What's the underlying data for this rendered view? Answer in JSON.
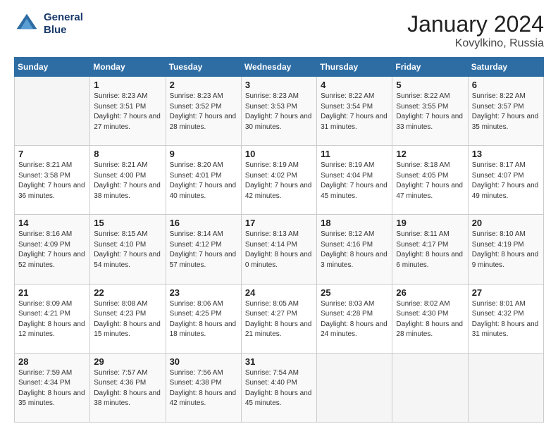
{
  "logo": {
    "line1": "General",
    "line2": "Blue"
  },
  "title": "January 2024",
  "subtitle": "Kovylkino, Russia",
  "columns": [
    "Sunday",
    "Monday",
    "Tuesday",
    "Wednesday",
    "Thursday",
    "Friday",
    "Saturday"
  ],
  "weeks": [
    [
      {
        "day": "",
        "sunrise": "",
        "sunset": "",
        "daylight": ""
      },
      {
        "day": "1",
        "sunrise": "Sunrise: 8:23 AM",
        "sunset": "Sunset: 3:51 PM",
        "daylight": "Daylight: 7 hours and 27 minutes."
      },
      {
        "day": "2",
        "sunrise": "Sunrise: 8:23 AM",
        "sunset": "Sunset: 3:52 PM",
        "daylight": "Daylight: 7 hours and 28 minutes."
      },
      {
        "day": "3",
        "sunrise": "Sunrise: 8:23 AM",
        "sunset": "Sunset: 3:53 PM",
        "daylight": "Daylight: 7 hours and 30 minutes."
      },
      {
        "day": "4",
        "sunrise": "Sunrise: 8:22 AM",
        "sunset": "Sunset: 3:54 PM",
        "daylight": "Daylight: 7 hours and 31 minutes."
      },
      {
        "day": "5",
        "sunrise": "Sunrise: 8:22 AM",
        "sunset": "Sunset: 3:55 PM",
        "daylight": "Daylight: 7 hours and 33 minutes."
      },
      {
        "day": "6",
        "sunrise": "Sunrise: 8:22 AM",
        "sunset": "Sunset: 3:57 PM",
        "daylight": "Daylight: 7 hours and 35 minutes."
      }
    ],
    [
      {
        "day": "7",
        "sunrise": "Sunrise: 8:21 AM",
        "sunset": "Sunset: 3:58 PM",
        "daylight": "Daylight: 7 hours and 36 minutes."
      },
      {
        "day": "8",
        "sunrise": "Sunrise: 8:21 AM",
        "sunset": "Sunset: 4:00 PM",
        "daylight": "Daylight: 7 hours and 38 minutes."
      },
      {
        "day": "9",
        "sunrise": "Sunrise: 8:20 AM",
        "sunset": "Sunset: 4:01 PM",
        "daylight": "Daylight: 7 hours and 40 minutes."
      },
      {
        "day": "10",
        "sunrise": "Sunrise: 8:19 AM",
        "sunset": "Sunset: 4:02 PM",
        "daylight": "Daylight: 7 hours and 42 minutes."
      },
      {
        "day": "11",
        "sunrise": "Sunrise: 8:19 AM",
        "sunset": "Sunset: 4:04 PM",
        "daylight": "Daylight: 7 hours and 45 minutes."
      },
      {
        "day": "12",
        "sunrise": "Sunrise: 8:18 AM",
        "sunset": "Sunset: 4:05 PM",
        "daylight": "Daylight: 7 hours and 47 minutes."
      },
      {
        "day": "13",
        "sunrise": "Sunrise: 8:17 AM",
        "sunset": "Sunset: 4:07 PM",
        "daylight": "Daylight: 7 hours and 49 minutes."
      }
    ],
    [
      {
        "day": "14",
        "sunrise": "Sunrise: 8:16 AM",
        "sunset": "Sunset: 4:09 PM",
        "daylight": "Daylight: 7 hours and 52 minutes."
      },
      {
        "day": "15",
        "sunrise": "Sunrise: 8:15 AM",
        "sunset": "Sunset: 4:10 PM",
        "daylight": "Daylight: 7 hours and 54 minutes."
      },
      {
        "day": "16",
        "sunrise": "Sunrise: 8:14 AM",
        "sunset": "Sunset: 4:12 PM",
        "daylight": "Daylight: 7 hours and 57 minutes."
      },
      {
        "day": "17",
        "sunrise": "Sunrise: 8:13 AM",
        "sunset": "Sunset: 4:14 PM",
        "daylight": "Daylight: 8 hours and 0 minutes."
      },
      {
        "day": "18",
        "sunrise": "Sunrise: 8:12 AM",
        "sunset": "Sunset: 4:16 PM",
        "daylight": "Daylight: 8 hours and 3 minutes."
      },
      {
        "day": "19",
        "sunrise": "Sunrise: 8:11 AM",
        "sunset": "Sunset: 4:17 PM",
        "daylight": "Daylight: 8 hours and 6 minutes."
      },
      {
        "day": "20",
        "sunrise": "Sunrise: 8:10 AM",
        "sunset": "Sunset: 4:19 PM",
        "daylight": "Daylight: 8 hours and 9 minutes."
      }
    ],
    [
      {
        "day": "21",
        "sunrise": "Sunrise: 8:09 AM",
        "sunset": "Sunset: 4:21 PM",
        "daylight": "Daylight: 8 hours and 12 minutes."
      },
      {
        "day": "22",
        "sunrise": "Sunrise: 8:08 AM",
        "sunset": "Sunset: 4:23 PM",
        "daylight": "Daylight: 8 hours and 15 minutes."
      },
      {
        "day": "23",
        "sunrise": "Sunrise: 8:06 AM",
        "sunset": "Sunset: 4:25 PM",
        "daylight": "Daylight: 8 hours and 18 minutes."
      },
      {
        "day": "24",
        "sunrise": "Sunrise: 8:05 AM",
        "sunset": "Sunset: 4:27 PM",
        "daylight": "Daylight: 8 hours and 21 minutes."
      },
      {
        "day": "25",
        "sunrise": "Sunrise: 8:03 AM",
        "sunset": "Sunset: 4:28 PM",
        "daylight": "Daylight: 8 hours and 24 minutes."
      },
      {
        "day": "26",
        "sunrise": "Sunrise: 8:02 AM",
        "sunset": "Sunset: 4:30 PM",
        "daylight": "Daylight: 8 hours and 28 minutes."
      },
      {
        "day": "27",
        "sunrise": "Sunrise: 8:01 AM",
        "sunset": "Sunset: 4:32 PM",
        "daylight": "Daylight: 8 hours and 31 minutes."
      }
    ],
    [
      {
        "day": "28",
        "sunrise": "Sunrise: 7:59 AM",
        "sunset": "Sunset: 4:34 PM",
        "daylight": "Daylight: 8 hours and 35 minutes."
      },
      {
        "day": "29",
        "sunrise": "Sunrise: 7:57 AM",
        "sunset": "Sunset: 4:36 PM",
        "daylight": "Daylight: 8 hours and 38 minutes."
      },
      {
        "day": "30",
        "sunrise": "Sunrise: 7:56 AM",
        "sunset": "Sunset: 4:38 PM",
        "daylight": "Daylight: 8 hours and 42 minutes."
      },
      {
        "day": "31",
        "sunrise": "Sunrise: 7:54 AM",
        "sunset": "Sunset: 4:40 PM",
        "daylight": "Daylight: 8 hours and 45 minutes."
      },
      {
        "day": "",
        "sunrise": "",
        "sunset": "",
        "daylight": ""
      },
      {
        "day": "",
        "sunrise": "",
        "sunset": "",
        "daylight": ""
      },
      {
        "day": "",
        "sunrise": "",
        "sunset": "",
        "daylight": ""
      }
    ]
  ]
}
